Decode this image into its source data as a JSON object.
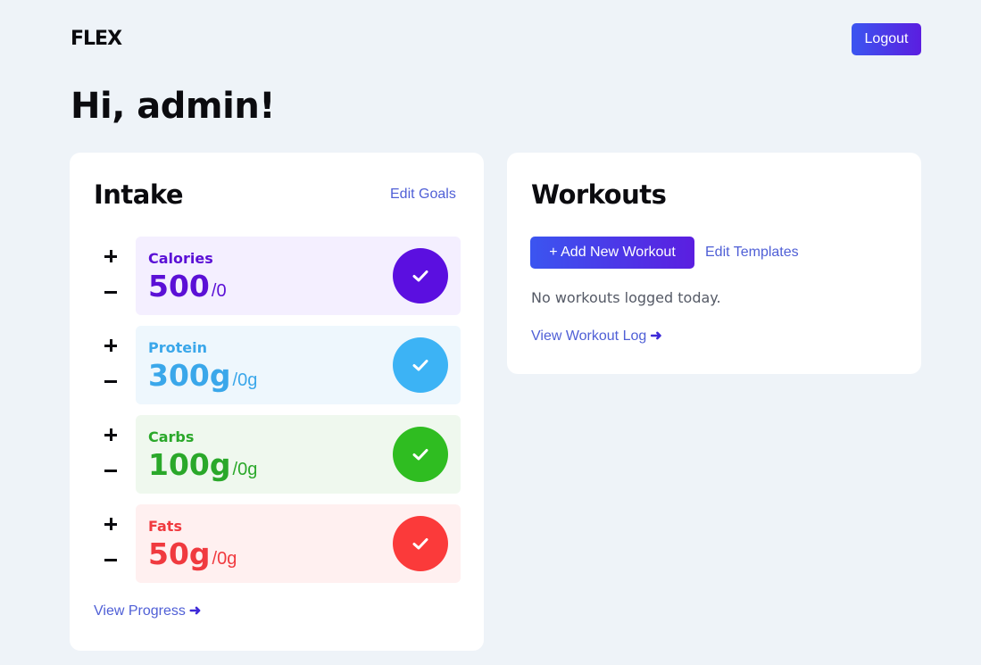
{
  "header": {
    "logo": "FLEX",
    "logout_label": "Logout"
  },
  "greeting": "Hi, admin!",
  "intake": {
    "title": "Intake",
    "edit_goals_label": "Edit Goals",
    "view_progress_label": "View Progress",
    "macros": [
      {
        "name": "Calories",
        "goal": "500",
        "current": "/0",
        "color": "#5b10d6",
        "bg": "#f4efff",
        "check_color": "#5b0fe0"
      },
      {
        "name": "Protein",
        "goal": "300g",
        "current": "/0g",
        "color": "#3aa7ea",
        "bg": "#eef7fd",
        "check_color": "#3cb3f5"
      },
      {
        "name": "Carbs",
        "goal": "100g",
        "current": "/0g",
        "color": "#2aa82a",
        "bg": "#eff8ee",
        "check_color": "#2fbd21"
      },
      {
        "name": "Fats",
        "goal": "50g",
        "current": "/0g",
        "color": "#f03a3f",
        "bg": "#fff0f0",
        "check_color": "#fb3a3a"
      }
    ]
  },
  "workouts": {
    "title": "Workouts",
    "add_label": "+ Add New Workout",
    "edit_templates_label": "Edit Templates",
    "empty_message": "No workouts logged today.",
    "view_log_label": "View Workout Log"
  },
  "icons": {
    "check": "check-icon",
    "arrow": "arrow-right-icon",
    "plus": "plus-icon",
    "minus": "minus-icon"
  }
}
